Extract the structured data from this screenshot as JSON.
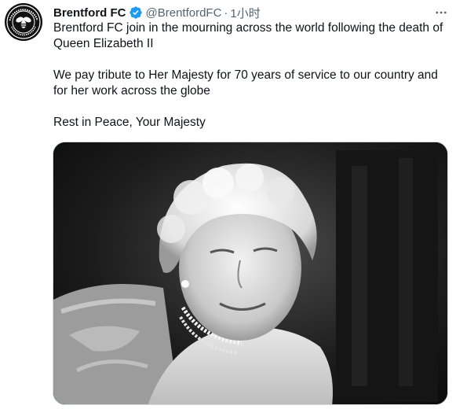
{
  "tweet": {
    "author": {
      "name": "Brentford FC",
      "handle": "@BrentfordFC",
      "verified": true,
      "avatar_icon": "brentford-bee-crest-icon"
    },
    "separator": "·",
    "time": "1小时",
    "more_icon": "more-horizontal-icon",
    "paragraphs": [
      "Brentford FC join in the mourning across the world following the death of Queen Elizabeth II",
      "We pay tribute to Her Majesty for 70 years of service to our country and for her work across the globe",
      "Rest in Peace, Your Majesty"
    ],
    "media": {
      "type": "photo",
      "style": "black-and-white portrait"
    }
  },
  "colors": {
    "text_primary": "#0f1419",
    "text_secondary": "#536471",
    "verified_blue": "#1d9bf0"
  }
}
